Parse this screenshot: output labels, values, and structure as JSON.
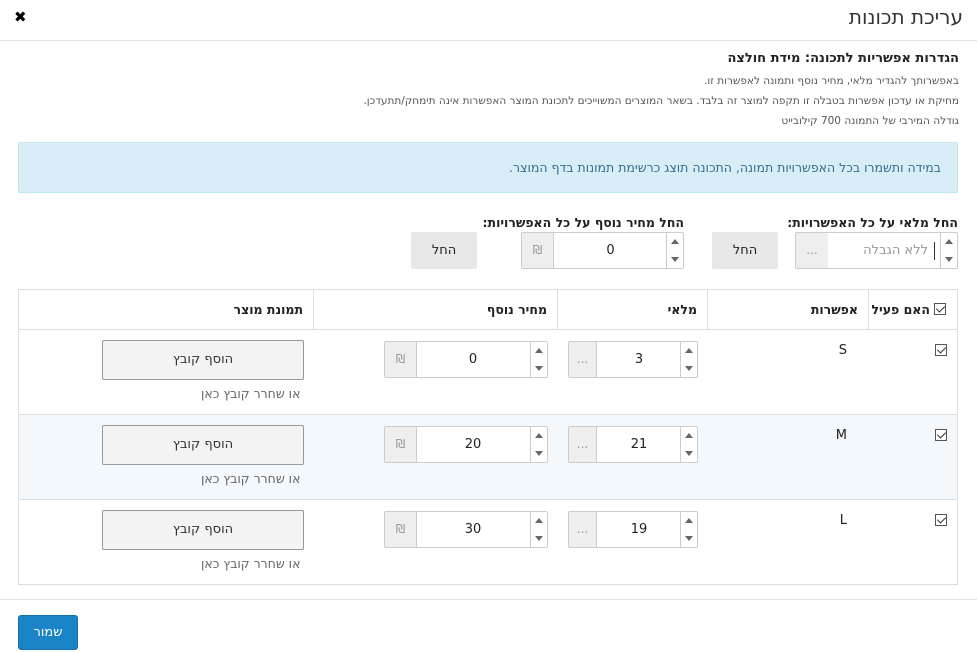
{
  "header": {
    "title": "עריכת תכונות",
    "close_glyph": "✖"
  },
  "settings": {
    "section_title": "הגדרות אפשריות לתכונה: מידת חולצה",
    "notes": [
      "באפשרותך להגדיר מלאי, מחיר נוסף ותמונה לאפשרות זו.",
      "מחיקת או עדכון אפשרות בטבלה זו תקפה למוצר זה בלבד. בשאר המוצרים המשוייכים לתכונת המוצר האפשרות אינה תימחק/תתעדכן.",
      "גודלה המירבי של התמונה 700 קילובייט"
    ]
  },
  "alert": {
    "text": "במידה ותשמרו בכל האפשרויות תמונה, התכונה תוצג כרשימת תמונות בדף המוצר."
  },
  "bulk": {
    "stock_label": "החל מלאי על כל האפשרויות:",
    "stock_placeholder": "ללא הגבלה",
    "stock_addon": "...",
    "stock_apply": "החל",
    "price_label": "החל מחיר נוסף על כל האפשרויות:",
    "price_value": "0",
    "price_addon": "₪",
    "price_apply": "החל"
  },
  "table": {
    "headers": {
      "active": "האם פעיל",
      "option": "אפשרות",
      "stock": "מלאי",
      "price": "מחיר נוסף",
      "image": "תמונת מוצר"
    },
    "rows": [
      {
        "option": "S",
        "stock": "3",
        "stock_addon": "...",
        "price": "0",
        "price_addon": "₪",
        "file_button": "הוסף קובץ",
        "drop_text": "או שחרר קובץ כאן",
        "active": true
      },
      {
        "option": "M",
        "stock": "21",
        "stock_addon": "...",
        "price": "20",
        "price_addon": "₪",
        "file_button": "הוסף קובץ",
        "drop_text": "או שחרר קובץ כאן",
        "active": true
      },
      {
        "option": "L",
        "stock": "19",
        "stock_addon": "...",
        "price": "30",
        "price_addon": "₪",
        "file_button": "הוסף קובץ",
        "drop_text": "או שחרר קובץ כאן",
        "active": true
      }
    ]
  },
  "footer": {
    "save_label": "שמור"
  },
  "colors": {
    "primary": "#1b84c7",
    "alert_bg": "#d9edf7",
    "alert_text": "#31708f",
    "row_alt": "#f3f8fd"
  }
}
